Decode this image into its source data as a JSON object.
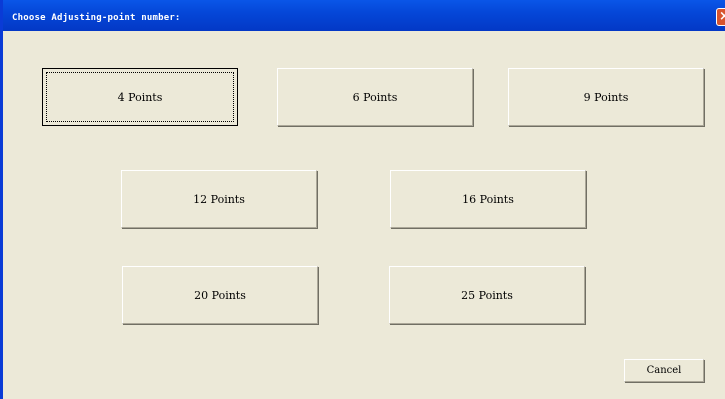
{
  "window": {
    "title": "Choose Adjusting-point number:",
    "close_icon": "close-icon",
    "titlebar_color": "#0547d8",
    "background_color": "#ece9d8"
  },
  "buttons": {
    "points_4": "4 Points",
    "points_6": "6 Points",
    "points_9": "9 Points",
    "points_12": "12 Points",
    "points_16": "16 Points",
    "points_20": "20 Points",
    "points_25": "25 Points",
    "cancel": "Cancel"
  }
}
